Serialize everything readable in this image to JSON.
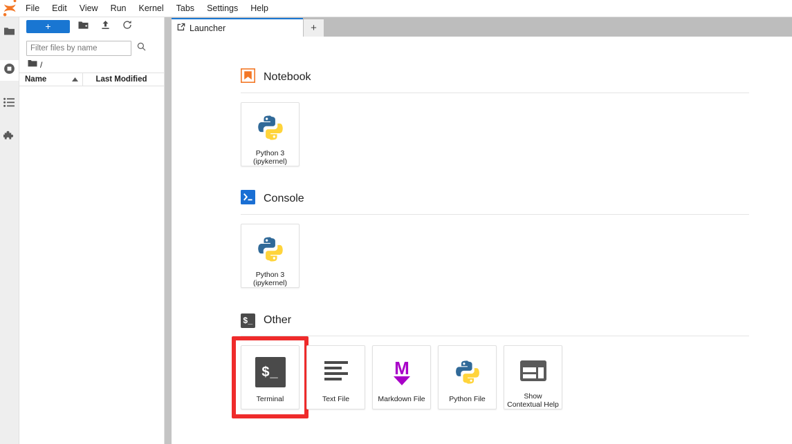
{
  "app": {
    "logo": "jupyter-logo",
    "menu": [
      "File",
      "Edit",
      "View",
      "Run",
      "Kernel",
      "Tabs",
      "Settings",
      "Help"
    ]
  },
  "rail": {
    "items": [
      {
        "name": "file-browser",
        "icon": "folder-icon",
        "active": false
      },
      {
        "name": "running-terminals",
        "icon": "running-icon",
        "active": true
      },
      {
        "name": "table-of-contents",
        "icon": "list-icon",
        "active": false
      },
      {
        "name": "extension-manager",
        "icon": "puzzle-icon",
        "active": false
      }
    ]
  },
  "filebrowser": {
    "new_launcher_label": "+",
    "toolbar_icons": [
      "new-folder-icon",
      "upload-icon",
      "refresh-icon"
    ],
    "filter": {
      "placeholder": "Filter files by name",
      "value": ""
    },
    "breadcrumb": {
      "icon": "folder-icon",
      "path": "/"
    },
    "columns": {
      "name": "Name",
      "last_modified": "Last Modified"
    },
    "sort_indicator": "ascending",
    "rows": []
  },
  "tabbar": {
    "tabs": [
      {
        "label": "Launcher",
        "icon": "launcher-icon",
        "active": true
      }
    ],
    "add_tab_label": "+"
  },
  "launcher": {
    "sections": [
      {
        "title": "Notebook",
        "icon": "notebook-icon",
        "icon_color": "#f37726",
        "cards": [
          {
            "label": "Python 3\n(ipykernel)",
            "icon": "python-icon",
            "highlighted": false
          }
        ]
      },
      {
        "title": "Console",
        "icon": "console-icon",
        "icon_color": "#1a6fd4",
        "cards": [
          {
            "label": "Python 3\n(ipykernel)",
            "icon": "python-icon",
            "highlighted": false
          }
        ]
      },
      {
        "title": "Other",
        "icon": "terminal-icon",
        "icon_color": "#4a4a4a",
        "cards": [
          {
            "label": "Terminal",
            "icon": "terminal-icon",
            "highlighted": true
          },
          {
            "label": "Text File",
            "icon": "text-file-icon",
            "highlighted": false
          },
          {
            "label": "Markdown File",
            "icon": "markdown-icon",
            "highlighted": false
          },
          {
            "label": "Python File",
            "icon": "python-icon",
            "highlighted": false
          },
          {
            "label": "Show\nContextual Help",
            "icon": "contextual-help-icon",
            "highlighted": false
          }
        ]
      }
    ]
  },
  "colors": {
    "accent_blue": "#1976d2",
    "highlight_red": "#ef2b2b",
    "jupyter_orange": "#f37726",
    "terminal_gray": "#4a4a4a",
    "markdown_purple": "#a800c8"
  }
}
